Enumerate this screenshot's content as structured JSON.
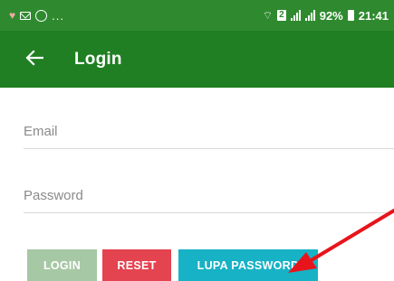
{
  "status_bar": {
    "more": "...",
    "sim": "2",
    "battery": "92%",
    "time": "21:41"
  },
  "app_bar": {
    "back_icon": "arrow-left",
    "title": "Login"
  },
  "form": {
    "email_placeholder": "Email",
    "email_value": "",
    "password_placeholder": "Password",
    "password_value": ""
  },
  "buttons": {
    "login": "LOGIN",
    "reset": "RESET",
    "lupa_password": "LUPA PASSWORD"
  },
  "colors": {
    "status_bar": "#2f8a2f",
    "app_bar": "#1f7f22",
    "login_button": "#a7c8a5",
    "reset_button": "#e44350",
    "lupa_button": "#17b2c6",
    "annotation_arrow": "#e8141b"
  }
}
